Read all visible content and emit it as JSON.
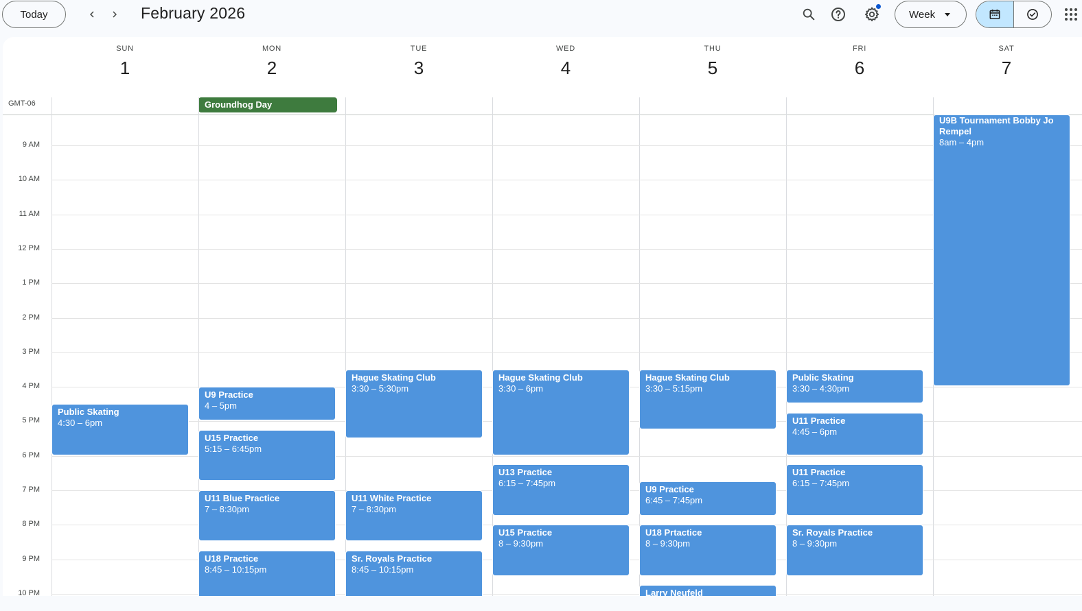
{
  "header": {
    "today_label": "Today",
    "month_title": "February 2026",
    "view_label": "Week",
    "settings_has_notification": true
  },
  "calendar": {
    "timezone": "GMT-06",
    "days": [
      {
        "dow": "SUN",
        "date": "1"
      },
      {
        "dow": "MON",
        "date": "2"
      },
      {
        "dow": "TUE",
        "date": "3"
      },
      {
        "dow": "WED",
        "date": "4"
      },
      {
        "dow": "THU",
        "date": "5"
      },
      {
        "dow": "FRI",
        "date": "6"
      },
      {
        "dow": "SAT",
        "date": "7"
      }
    ],
    "hours": [
      "9 AM",
      "10 AM",
      "11 AM",
      "12 PM",
      "1 PM",
      "2 PM",
      "3 PM",
      "4 PM",
      "5 PM",
      "6 PM",
      "7 PM",
      "8 PM",
      "9 PM",
      "10 PM"
    ],
    "all_day_events": [
      {
        "day": 1,
        "title": "Groundhog Day",
        "color": "#3e7b3e"
      }
    ],
    "events": [
      {
        "day": 0,
        "title": "Public Skating",
        "time": "4:30 – 6pm",
        "start": 16.5,
        "end": 18.0
      },
      {
        "day": 1,
        "title": "U9 Practice",
        "time": "4 – 5pm",
        "start": 16.0,
        "end": 17.0
      },
      {
        "day": 1,
        "title": "U15 Practice",
        "time": "5:15 – 6:45pm",
        "start": 17.25,
        "end": 18.75
      },
      {
        "day": 1,
        "title": "U11 Blue Practice",
        "time": "7 – 8:30pm",
        "start": 19.0,
        "end": 20.5
      },
      {
        "day": 1,
        "title": "U18 Practice",
        "time": "8:45 – 10:15pm",
        "start": 20.75,
        "end": 22.25
      },
      {
        "day": 2,
        "title": "Hague Skating Club",
        "time": "3:30 – 5:30pm",
        "start": 15.5,
        "end": 17.5
      },
      {
        "day": 2,
        "title": "U11 White Practice",
        "time": "7 – 8:30pm",
        "start": 19.0,
        "end": 20.5
      },
      {
        "day": 2,
        "title": "Sr. Royals Practice",
        "time": "8:45 – 10:15pm",
        "start": 20.75,
        "end": 22.25
      },
      {
        "day": 3,
        "title": "Hague Skating Club",
        "time": "3:30 – 6pm",
        "start": 15.5,
        "end": 18.0
      },
      {
        "day": 3,
        "title": "U13 Practice",
        "time": "6:15 – 7:45pm",
        "start": 18.25,
        "end": 19.75
      },
      {
        "day": 3,
        "title": "U15 Practice",
        "time": "8 – 9:30pm",
        "start": 20.0,
        "end": 21.5
      },
      {
        "day": 4,
        "title": "Hague Skating Club",
        "time": "3:30 – 5:15pm",
        "start": 15.5,
        "end": 17.25
      },
      {
        "day": 4,
        "title": "U9 Practice",
        "time": "6:45 – 7:45pm",
        "start": 18.75,
        "end": 19.75
      },
      {
        "day": 4,
        "title": "U18 Prtactice",
        "time": "8 – 9:30pm",
        "start": 20.0,
        "end": 21.5
      },
      {
        "day": 4,
        "title": "Larry Neufeld",
        "time": "",
        "start": 21.75,
        "end": 23.0
      },
      {
        "day": 5,
        "title": "Public Skating",
        "time": "3:30 – 4:30pm",
        "start": 15.5,
        "end": 16.5
      },
      {
        "day": 5,
        "title": "U11 Practice",
        "time": "4:45 – 6pm",
        "start": 16.75,
        "end": 18.0
      },
      {
        "day": 5,
        "title": "U11 Practice",
        "time": "6:15 – 7:45pm",
        "start": 18.25,
        "end": 19.75
      },
      {
        "day": 5,
        "title": "Sr. Royals Practice",
        "time": "8 – 9:30pm",
        "start": 20.0,
        "end": 21.5
      },
      {
        "day": 6,
        "title": "U9B Tournament Bobby Jo Rempel",
        "time": "8am – 4pm",
        "start": 8.0,
        "end": 16.0
      }
    ],
    "event_color": "#4f94dd"
  }
}
